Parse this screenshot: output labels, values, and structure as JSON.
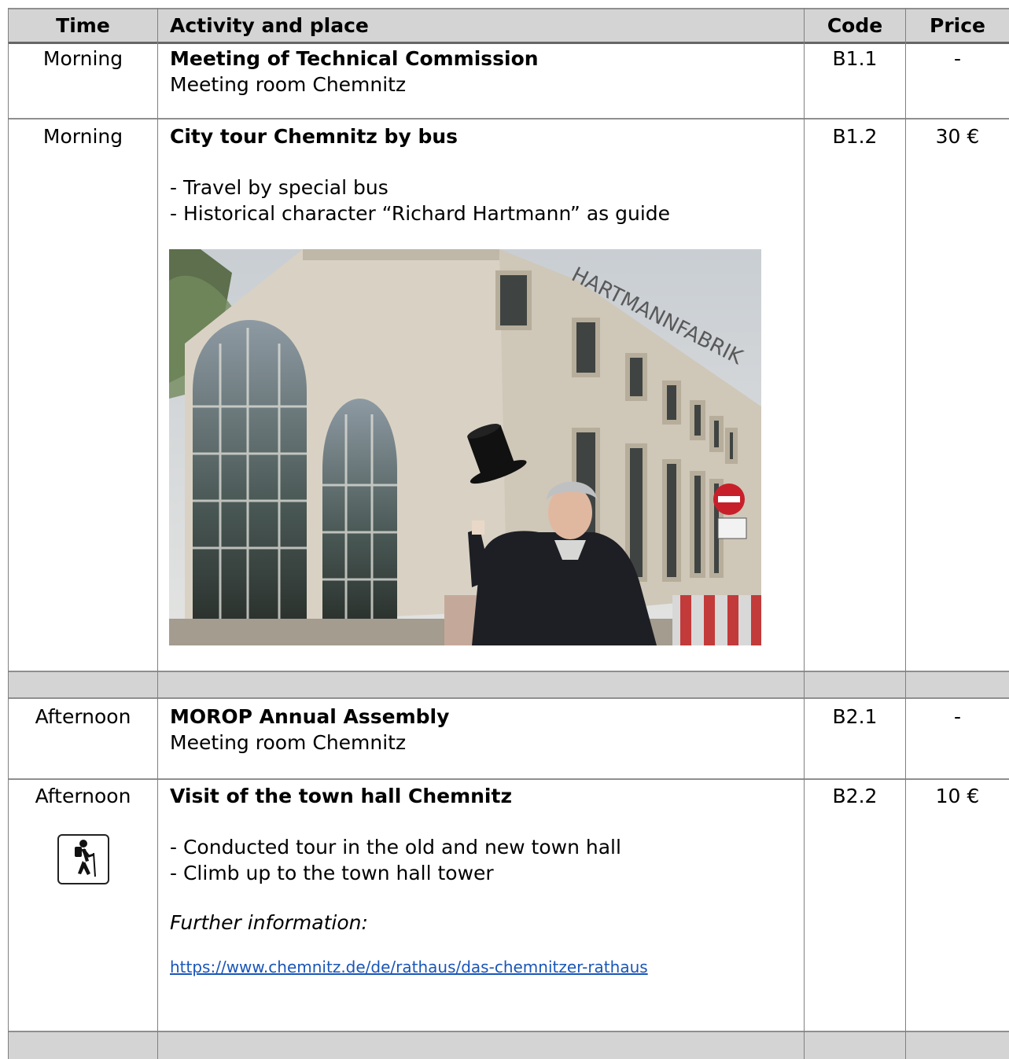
{
  "header": {
    "time": "Time",
    "activity": "Activity and place",
    "code": "Code",
    "price": "Price"
  },
  "rows": [
    {
      "time": "Morning",
      "title": "Meeting of Technical Commission",
      "place": "Meeting room Chemnitz",
      "code": "B1.1",
      "price": "-"
    },
    {
      "time": "Morning",
      "title": "City tour Chemnitz by bus",
      "bullets": [
        "Travel by special bus",
        "Historical character “Richard Hartmann” as guide"
      ],
      "code": "B1.2",
      "price": "30 €",
      "image_sign": "HARTMANNFABRIK",
      "image_icon": "photo-building-with-top-hat-guide"
    },
    {
      "time": "Afternoon",
      "title": "MOROP Annual Assembly",
      "place": "Meeting room Chemnitz",
      "code": "B2.1",
      "price": "-"
    },
    {
      "time": "Afternoon",
      "title": "Visit of the town hall Chemnitz",
      "bullets": [
        "Conducted tour in the old and new town hall",
        "Climb up to the town hall tower"
      ],
      "further_label": "Further information:",
      "link": "https://www.chemnitz.de/de/rathaus/das-chemnitzer-rathaus",
      "code": "B2.2",
      "price": "10 €",
      "icon": "hiking-icon"
    }
  ],
  "colors": {
    "header_bg": "#d4d4d4",
    "separator_band": "#d4d4d4",
    "link": "#1a56b8",
    "grid": "#808080"
  }
}
